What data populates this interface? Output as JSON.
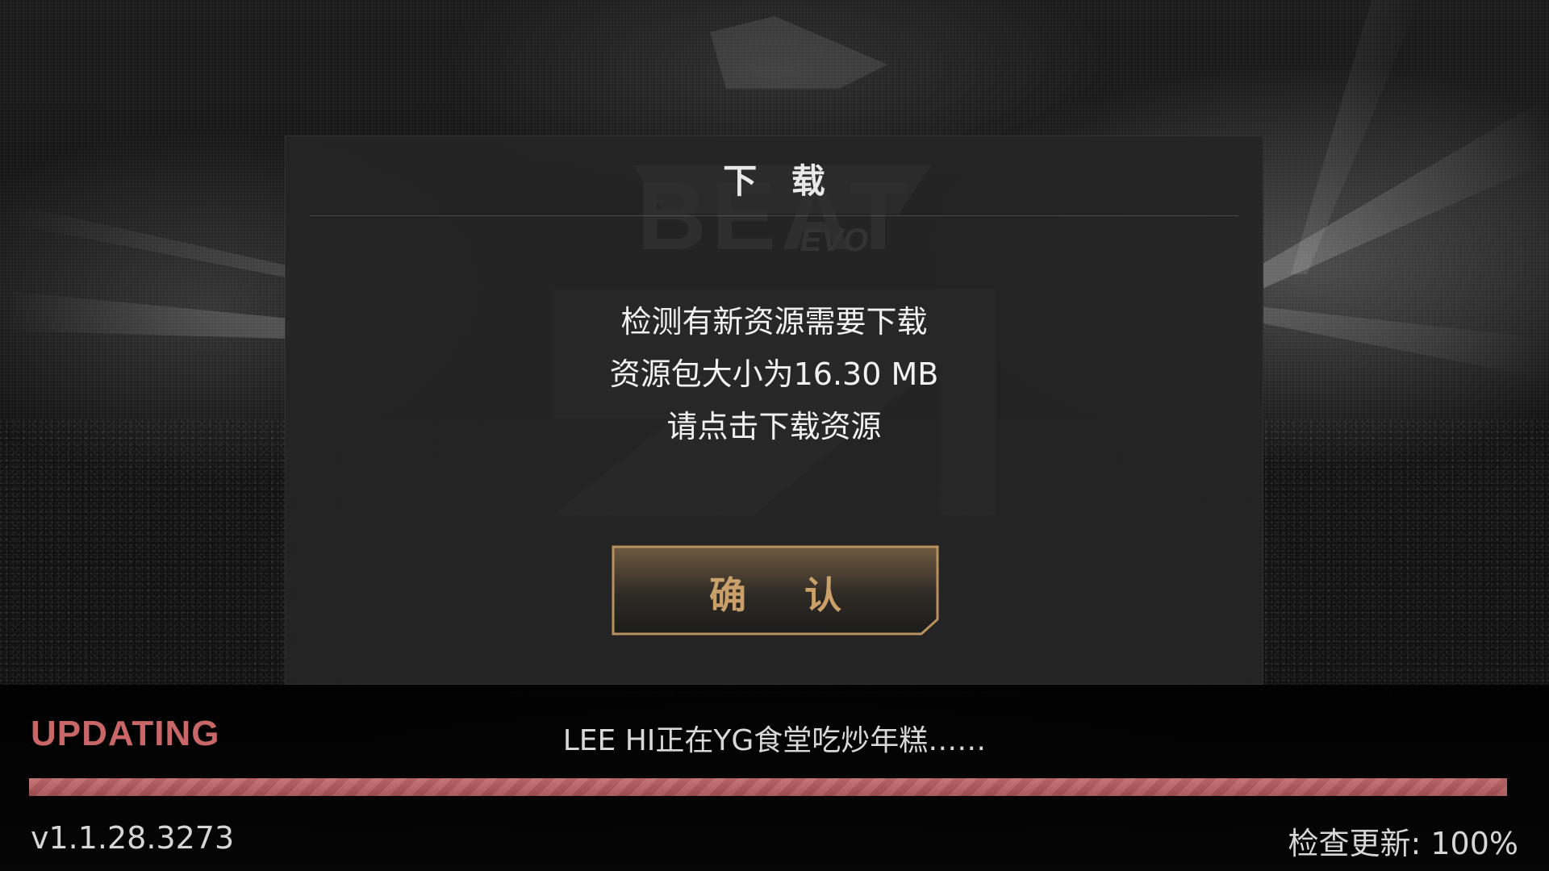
{
  "dialog": {
    "title": "下 载",
    "message_lines": [
      "检测有新资源需要下载",
      "资源包大小为16.30 MB",
      "请点击下载资源"
    ],
    "confirm_label": "确 认"
  },
  "status": {
    "updating_label": "UPDATING",
    "tip_text": "LEE HI正在YG食堂吃炒年糕……",
    "version": "v1.1.28.3273",
    "check_update_text": "检查更新: 100%",
    "progress_fraction": 1.0
  },
  "colors": {
    "accent_gold": "#c9a06a",
    "updating_red": "#c86668",
    "progress_red": "#b55a5d",
    "dialog_bg": "#242424"
  },
  "watermark": {
    "text": "BEAT",
    "sub_text": "EVO"
  }
}
